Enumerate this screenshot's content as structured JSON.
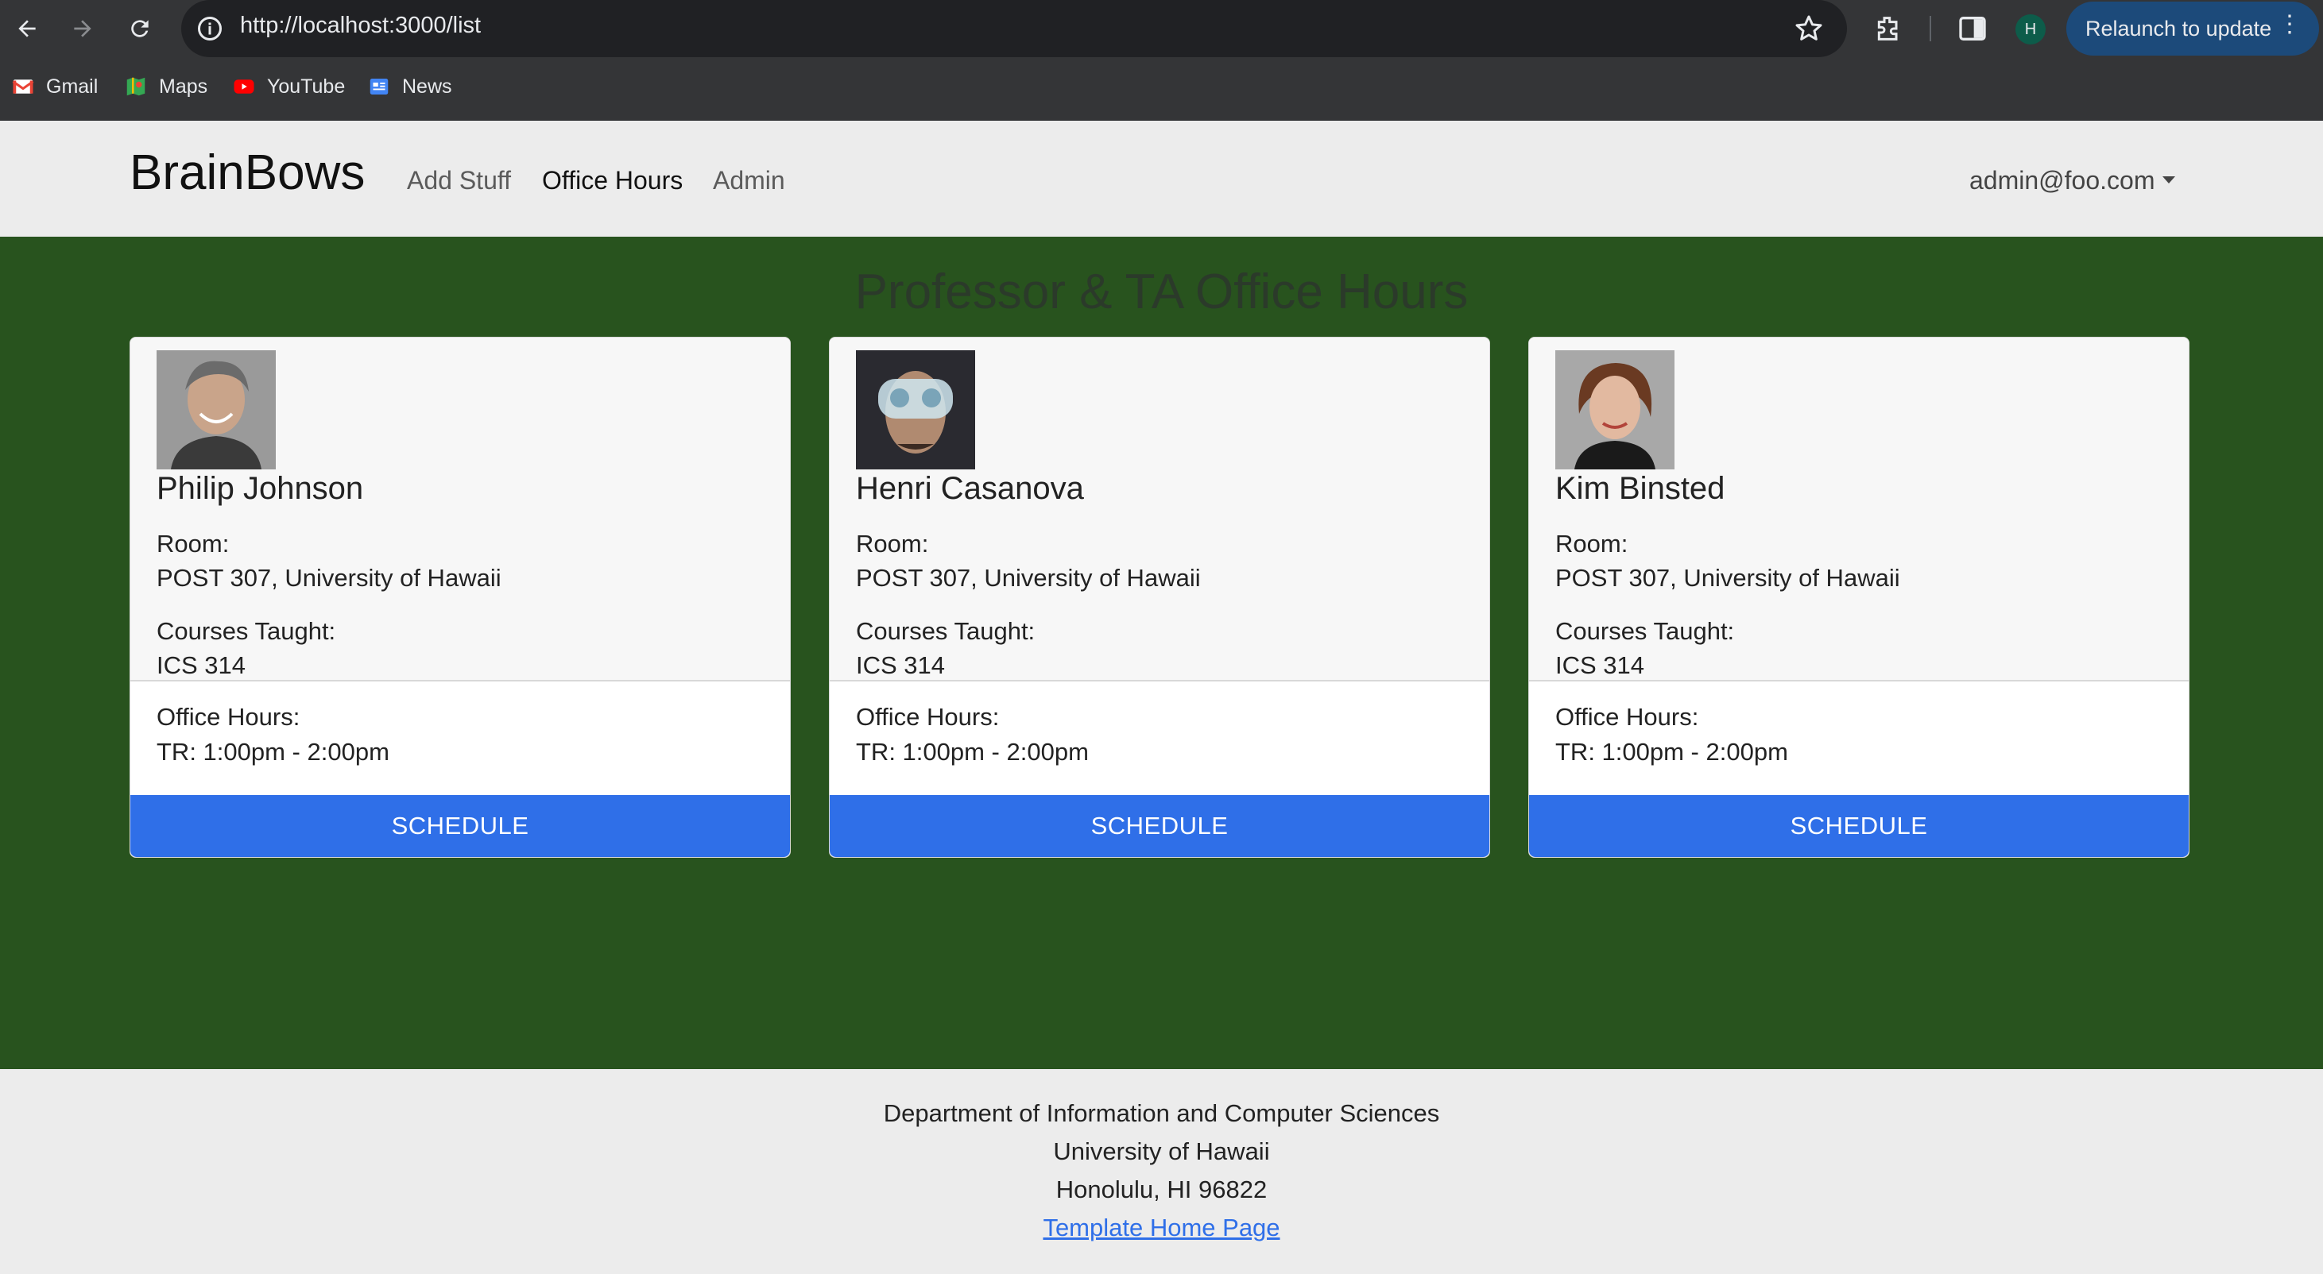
{
  "browser": {
    "url": "http://localhost:3000/list",
    "profile_initial": "H",
    "relaunch_label": "Relaunch to update",
    "bookmarks": [
      {
        "label": "Gmail",
        "icon": "gmail-icon"
      },
      {
        "label": "Maps",
        "icon": "maps-icon"
      },
      {
        "label": "YouTube",
        "icon": "youtube-icon"
      },
      {
        "label": "News",
        "icon": "news-icon"
      }
    ]
  },
  "navbar": {
    "brand": "BrainBows",
    "links": [
      "Add Stuff",
      "Office Hours",
      "Admin"
    ],
    "active_link": "Office Hours",
    "user": "admin@foo.com"
  },
  "page": {
    "title": "Professor & TA Office Hours"
  },
  "cards": [
    {
      "name": "Philip Johnson",
      "room_label": "Room:",
      "room": "POST 307, University of Hawaii",
      "courses_label": "Courses Taught:",
      "courses": "ICS 314",
      "hours_label": "Office Hours:",
      "hours": "TR: 1:00pm - 2:00pm",
      "button": "SCHEDULE"
    },
    {
      "name": "Henri Casanova",
      "room_label": "Room:",
      "room": "POST 307, University of Hawaii",
      "courses_label": "Courses Taught:",
      "courses": "ICS 314",
      "hours_label": "Office Hours:",
      "hours": "TR: 1:00pm - 2:00pm",
      "button": "SCHEDULE"
    },
    {
      "name": "Kim Binsted",
      "room_label": "Room:",
      "room": "POST 307, University of Hawaii",
      "courses_label": "Courses Taught:",
      "courses": "ICS 314",
      "hours_label": "Office Hours:",
      "hours": "TR: 1:00pm - 2:00pm",
      "button": "SCHEDULE"
    }
  ],
  "footer": {
    "line1": "Department of Information and Computer Sciences",
    "line2": "University of Hawaii",
    "line3": "Honolulu, HI 96822",
    "link": "Template Home Page"
  },
  "colors": {
    "main_bg": "#28531e",
    "accent": "#2f6fe8",
    "navbar_bg": "#ececec"
  }
}
